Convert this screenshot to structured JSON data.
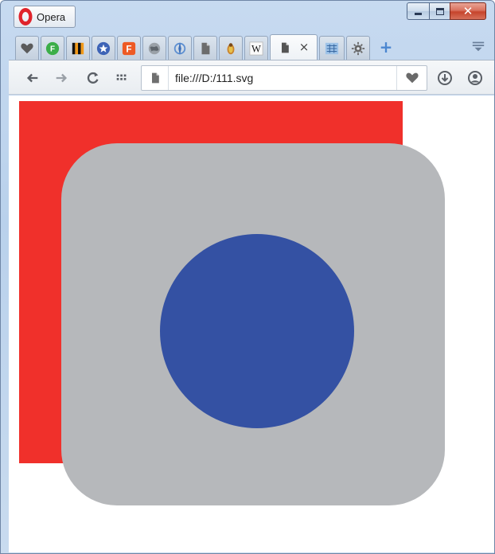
{
  "window": {
    "menu_label": "Opera",
    "controls": {
      "minimize": "—",
      "maximize": "☐",
      "close": "✕"
    }
  },
  "tabs": {
    "items": [
      {
        "icon": "heart-icon"
      },
      {
        "icon": "feedly-icon"
      },
      {
        "icon": "bookmarks-stripes-icon"
      },
      {
        "icon": "star-icon"
      },
      {
        "icon": "f-logo-icon"
      },
      {
        "icon": "globe-icon"
      },
      {
        "icon": "compass-icon"
      },
      {
        "icon": "page-icon"
      },
      {
        "icon": "bug-icon"
      },
      {
        "icon": "wikipedia-icon",
        "text": "W"
      },
      {
        "icon": "page-icon",
        "active": true,
        "close": "×"
      },
      {
        "icon": "grid-app-icon"
      },
      {
        "icon": "gear-icon"
      }
    ],
    "new_tab": "+",
    "menu": "☰"
  },
  "toolbar": {
    "back": "←",
    "forward": "→",
    "reload": "C",
    "speed_dial": "⋮⋮⋮",
    "address": "file:///D:/111.svg",
    "favorite": "heart-icon",
    "download": "download-icon",
    "account": "user-icon"
  },
  "content": {
    "colors": {
      "square": "#f0302b",
      "rounded_rect": "#b6b8bb",
      "circle": "#3451a3"
    }
  }
}
